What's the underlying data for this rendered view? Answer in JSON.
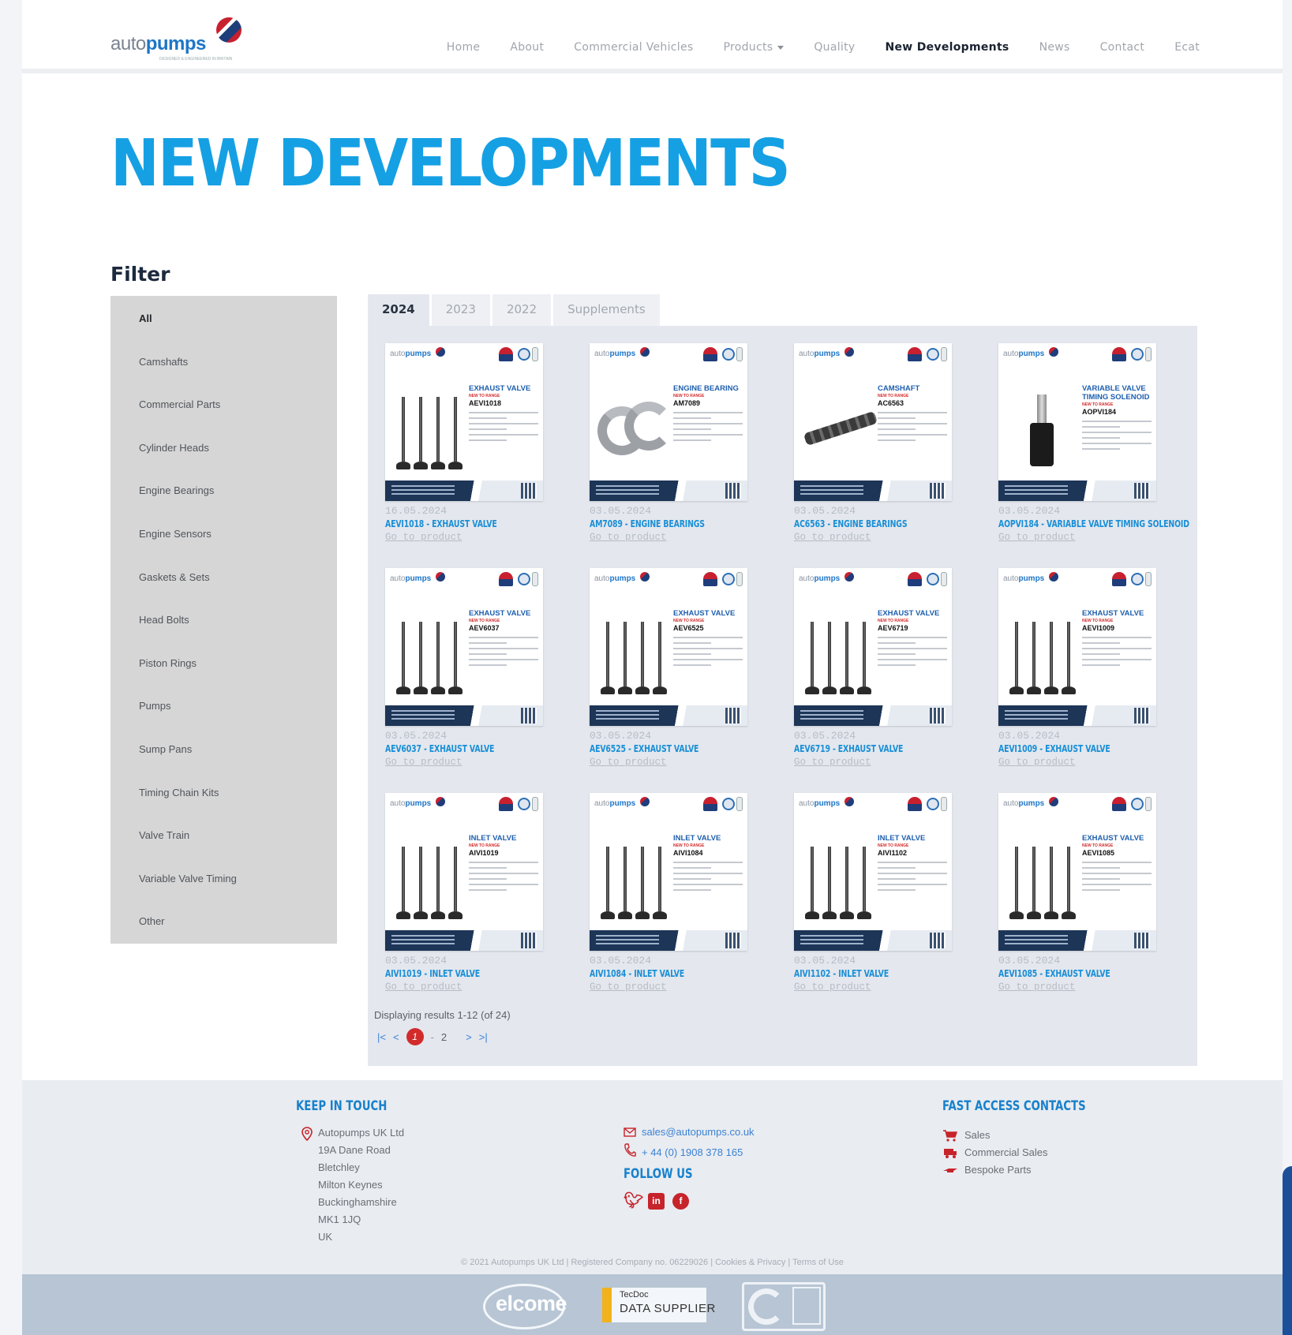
{
  "brand": {
    "logo_prefix": "auto",
    "logo_suffix": "pumps",
    "tagline": "DESIGNED & ENGINEERED IN BRITAIN"
  },
  "nav": {
    "items": [
      {
        "label": "Home"
      },
      {
        "label": "About"
      },
      {
        "label": "Commercial Vehicles"
      },
      {
        "label": "Products",
        "dropdown": true
      },
      {
        "label": "Quality"
      },
      {
        "label": "New Developments",
        "active": true
      },
      {
        "label": "News"
      },
      {
        "label": "Contact"
      },
      {
        "label": "Ecat"
      }
    ]
  },
  "page": {
    "title": "NEW DEVELOPMENTS",
    "filter_heading": "Filter"
  },
  "filter": {
    "items": [
      {
        "label": "All",
        "active": true
      },
      {
        "label": "Camshafts"
      },
      {
        "label": "Commercial Parts"
      },
      {
        "label": "Cylinder Heads"
      },
      {
        "label": "Engine Bearings"
      },
      {
        "label": "Engine Sensors"
      },
      {
        "label": "Gaskets & Sets"
      },
      {
        "label": "Head Bolts"
      },
      {
        "label": "Piston Rings"
      },
      {
        "label": "Pumps"
      },
      {
        "label": "Sump Pans"
      },
      {
        "label": "Timing Chain Kits"
      },
      {
        "label": "Valve Train"
      },
      {
        "label": "Variable Valve Timing"
      },
      {
        "label": "Other"
      }
    ]
  },
  "tabs": [
    {
      "label": "2024",
      "active": true
    },
    {
      "label": "2023"
    },
    {
      "label": "2022"
    },
    {
      "label": "Supplements"
    }
  ],
  "products": [
    {
      "date": "16.05.2024",
      "title": "AEVI1018 - EXHAUST VALVE",
      "link": "Go to product",
      "type": "EXHAUST VALVE",
      "code": "AEVI1018",
      "new_label": "NEW TO RANGE",
      "image": "valve"
    },
    {
      "date": "03.05.2024",
      "title": "AM7089 - ENGINE BEARINGS",
      "link": "Go to product",
      "type": "ENGINE BEARING",
      "code": "AM7089",
      "new_label": "NEW TO RANGE",
      "image": "bearing"
    },
    {
      "date": "03.05.2024",
      "title": "AC6563 - ENGINE BEARINGS",
      "link": "Go to product",
      "type": "CAMSHAFT",
      "code": "AC6563",
      "new_label": "NEW TO RANGE",
      "image": "camshaft"
    },
    {
      "date": "03.05.2024",
      "title": "AOPVI184 - VARIABLE VALVE TIMING SOLENOID",
      "link": "Go to product",
      "type": "VARIABLE VALVE TIMING SOLENOID",
      "code": "AOPVI184",
      "new_label": "NEW TO RANGE",
      "image": "solenoid"
    },
    {
      "date": "03.05.2024",
      "title": "AEV6037 - EXHAUST VALVE",
      "link": "Go to product",
      "type": "EXHAUST VALVE",
      "code": "AEV6037",
      "new_label": "NEW TO RANGE",
      "image": "valve"
    },
    {
      "date": "03.05.2024",
      "title": "AEV6525 - EXHAUST VALVE",
      "link": "Go to product",
      "type": "EXHAUST VALVE",
      "code": "AEV6525",
      "new_label": "NEW TO RANGE",
      "image": "valve"
    },
    {
      "date": "03.05.2024",
      "title": "AEV6719 - EXHAUST VALVE",
      "link": "Go to product",
      "type": "EXHAUST VALVE",
      "code": "AEV6719",
      "new_label": "NEW TO RANGE",
      "image": "valve"
    },
    {
      "date": "03.05.2024",
      "title": "AEVI1009 - EXHAUST VALVE",
      "link": "Go to product",
      "type": "EXHAUST VALVE",
      "code": "AEVI1009",
      "new_label": "NEW TO RANGE",
      "image": "valve"
    },
    {
      "date": "03.05.2024",
      "title": "AIVI1019 - INLET VALVE",
      "link": "Go to product",
      "type": "INLET VALVE",
      "code": "AIVI1019",
      "new_label": "NEW TO RANGE",
      "image": "valve"
    },
    {
      "date": "03.05.2024",
      "title": "AIVI1084 - INLET VALVE",
      "link": "Go to product",
      "type": "INLET VALVE",
      "code": "AIVI1084",
      "new_label": "NEW TO RANGE",
      "image": "valve"
    },
    {
      "date": "03.05.2024",
      "title": "AIVI1102 - INLET VALVE",
      "link": "Go to product",
      "type": "INLET VALVE",
      "code": "AIVI1102",
      "new_label": "NEW TO RANGE",
      "image": "valve"
    },
    {
      "date": "03.05.2024",
      "title": "AEVI1085 - EXHAUST VALVE",
      "link": "Go to product",
      "type": "EXHAUST VALVE",
      "code": "AEVI1085",
      "new_label": "NEW TO RANGE",
      "image": "valve"
    }
  ],
  "results": {
    "text": "Displaying results 1-12 (of 24)"
  },
  "pagination": {
    "first": "|<",
    "prev": "<",
    "current": "1",
    "separator": "-",
    "next_page": "2",
    "next": ">",
    "last": ">|"
  },
  "footer": {
    "keep_in_touch": "KEEP IN TOUCH",
    "address": [
      "Autopumps UK Ltd",
      "19A Dane Road",
      "Bletchley",
      "Milton Keynes",
      "Buckinghamshire",
      "MK1 1JQ",
      "UK"
    ],
    "email": "sales@autopumps.co.uk",
    "phone": "+ 44 (0) 1908 378 165",
    "follow_us": "FOLLOW US",
    "fast_access": "FAST ACCESS CONTACTS",
    "fast_items": [
      {
        "label": "Sales",
        "icon": "cart-icon"
      },
      {
        "label": "Commercial Sales",
        "icon": "truck-icon"
      },
      {
        "label": "Bespoke Parts",
        "icon": "part-icon"
      }
    ],
    "copyright": "© 2021 Autopumps UK Ltd | Registered Company no. 06229026 | Cookies & Privacy | Terms of Use"
  },
  "partners": {
    "elcome": "elcome",
    "tecdoc_top": "TecDoc",
    "tecdoc_bottom": "DATA SUPPLIER"
  },
  "colors": {
    "accent": "#15a0e4",
    "link": "#1a8fd6",
    "red": "#c7232b",
    "panel": "#e4e7ee",
    "sidebar": "#d6d6d6"
  }
}
